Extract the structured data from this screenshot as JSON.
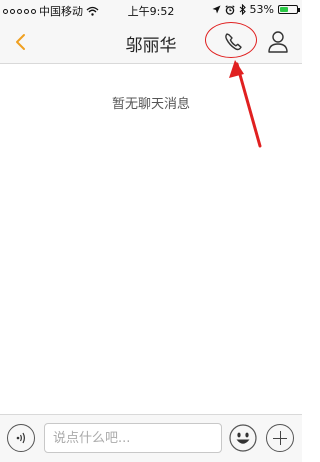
{
  "status_bar": {
    "carrier": "中国移动",
    "time": "上午9:52",
    "battery_text": "53%",
    "battery_level": 0.53,
    "icons": [
      "signal-dots-icon",
      "wifi-icon",
      "location-icon",
      "alarm-icon",
      "bluetooth-icon",
      "battery-icon"
    ]
  },
  "nav": {
    "title": "邬丽华",
    "back_icon": "chevron-left-icon",
    "call_icon": "phone-icon",
    "profile_icon": "person-icon"
  },
  "chat": {
    "empty_text": "暂无聊天消息"
  },
  "input": {
    "placeholder": "说点什么吧..."
  },
  "colors": {
    "accent": "#f0a020",
    "annotation": "#e02020",
    "battery": "#2ac845"
  }
}
